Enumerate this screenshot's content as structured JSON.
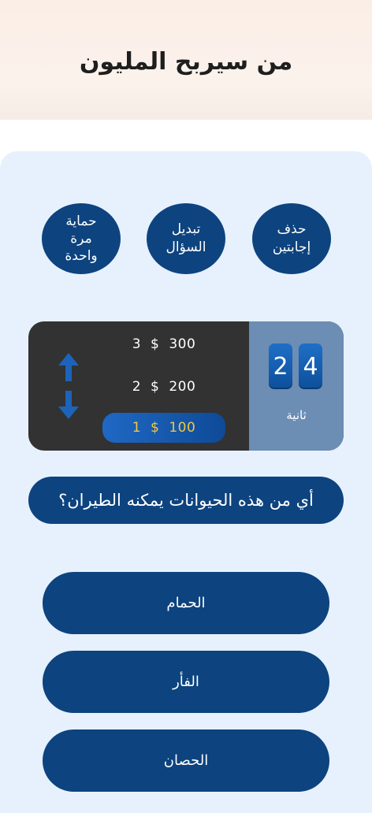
{
  "header": {
    "title": "من سيربح المليون"
  },
  "lifelines": [
    {
      "label": "حذف\nإجابتين"
    },
    {
      "label": "تبديل\nالسؤال"
    },
    {
      "label": "حماية\nمرة\nواحدة"
    }
  ],
  "timer": {
    "digit_left": "2",
    "digit_right": "4",
    "label": "ثانية"
  },
  "prizes": [
    {
      "level": "3",
      "currency": "$",
      "amount": "300"
    },
    {
      "level": "2",
      "currency": "$",
      "amount": "200"
    },
    {
      "level": "1",
      "currency": "$",
      "amount": "100"
    }
  ],
  "current_prize_level": 1,
  "question": {
    "text": "أي من هذه الحيوانات يمكنه الطيران؟"
  },
  "answers": [
    {
      "label": "الحمام"
    },
    {
      "label": "الفأر"
    },
    {
      "label": "الحصان"
    }
  ],
  "colors": {
    "primary": "#0d437f",
    "panel": "#e6f1fd",
    "highlight": "#f0c845"
  }
}
